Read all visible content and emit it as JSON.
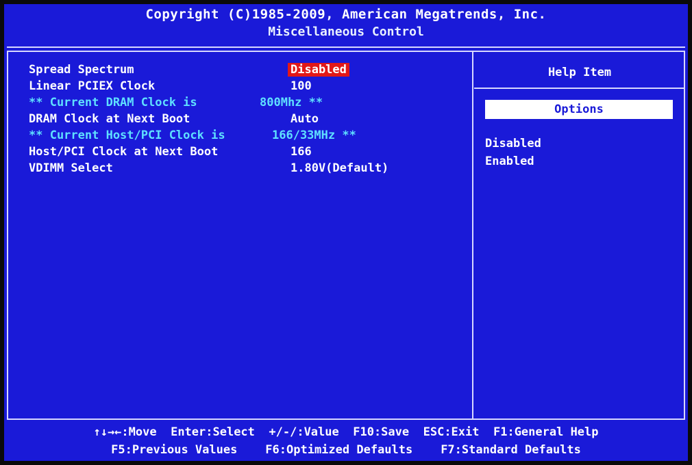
{
  "header": {
    "copyright": "Copyright (C)1985-2009, American Megatrends, Inc.",
    "title": "Miscellaneous Control"
  },
  "settings": [
    {
      "label": "Spread Spectrum",
      "value": "Disabled"
    },
    {
      "label": "Linear PCIEX Clock",
      "value": "100"
    },
    {
      "label": "** Current DRAM Clock is",
      "value": "800Mhz **"
    },
    {
      "label": "DRAM Clock at Next Boot",
      "value": "Auto"
    },
    {
      "label": "** Current Host/PCI Clock is",
      "value": "166/33MHz **"
    },
    {
      "label": "Host/PCI Clock at Next Boot",
      "value": "166"
    },
    {
      "label": "VDIMM Select",
      "value": "1.80V(Default)"
    }
  ],
  "help": {
    "title": "Help Item",
    "options_header": "Options",
    "options": [
      "Disabled",
      "Enabled"
    ]
  },
  "footer": {
    "move": "↑↓→←:Move",
    "select": "Enter:Select",
    "value": "+/-/:Value",
    "save": "F10:Save",
    "exit": "ESC:Exit",
    "general_help": "F1:General Help",
    "previous": "F5:Previous Values",
    "optimized": "F6:Optimized Defaults",
    "standard": "F7:Standard Defaults"
  },
  "colors": {
    "background": "#1a1ad8",
    "highlight": "#e21818",
    "info_text": "#5fe0ff",
    "text": "#ffffff"
  }
}
